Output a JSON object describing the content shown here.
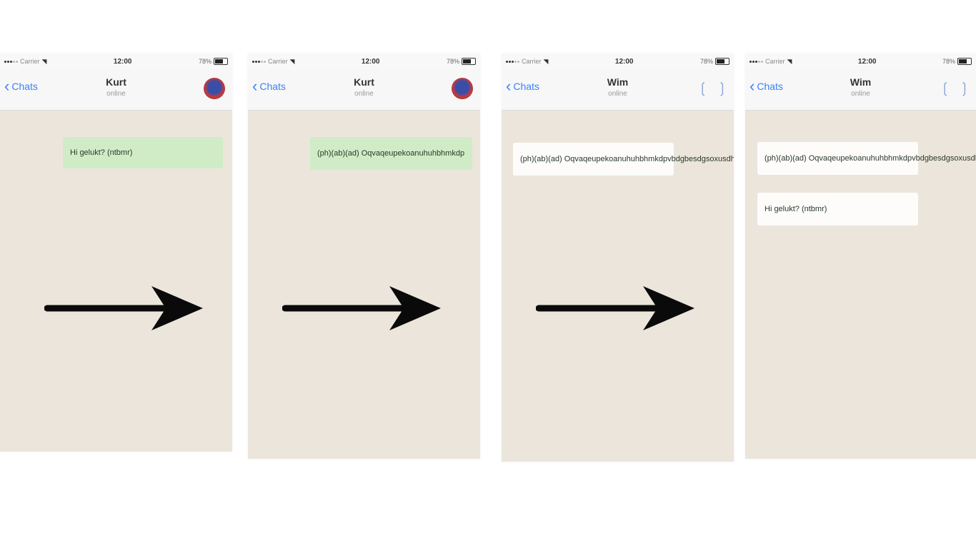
{
  "phones": [
    {
      "status": {
        "carrier": "Carrier",
        "time": "12:00",
        "battery": "78%"
      },
      "nav": {
        "back": "Chats",
        "title": "Kurt",
        "subtitle": "online"
      },
      "header_right": "avatar",
      "messages": [
        {
          "text": "Hi gelukt? (ntbmr)",
          "kind": "outgoing"
        }
      ]
    },
    {
      "status": {
        "carrier": "Carrier",
        "time": "12:00",
        "battery": "78%"
      },
      "nav": {
        "back": "Chats",
        "title": "Kurt",
        "subtitle": "online"
      },
      "header_right": "avatar",
      "messages": [
        {
          "text": "(ph)(ab)(ad) Oqvaqeupekoanuhuhbhmkdp",
          "kind": "outgoing"
        }
      ]
    },
    {
      "status": {
        "carrier": "Carrier",
        "time": "12:00",
        "battery": "78%"
      },
      "nav": {
        "back": "Chats",
        "title": "Wim",
        "subtitle": "online"
      },
      "header_right": "icons",
      "messages": [
        {
          "text": "(ph)(ab)(ad) Oqvaqeupekoanuhuhbhmkdpvbdgbesdgsoxusdhgf",
          "kind": "incoming"
        }
      ]
    },
    {
      "status": {
        "carrier": "Carrier",
        "time": "12:00",
        "battery": "78%"
      },
      "nav": {
        "back": "Chats",
        "title": "Wim",
        "subtitle": "online"
      },
      "header_right": "icons",
      "messages": [
        {
          "text": "(ph)(ab)(ad) Oqvaqeupekoanuhuhbhmkdpvbdgbesdgsoxusdhgf",
          "kind": "incoming"
        },
        {
          "text": "Hi gelukt? (ntbmr)",
          "kind": "incoming"
        }
      ]
    }
  ],
  "colors": {
    "chat_background": "#ece5dc",
    "outgoing_bubble": "#cfecc6",
    "incoming_bubble": "#fdfcfb",
    "link_blue": "#3b82f6",
    "arrow": "#0a0a0a"
  },
  "icons": {
    "back": "chevron-left-icon",
    "avatar": "avatar-image",
    "transition": "right-arrow-icon",
    "header_actions": "bracket-icons"
  }
}
